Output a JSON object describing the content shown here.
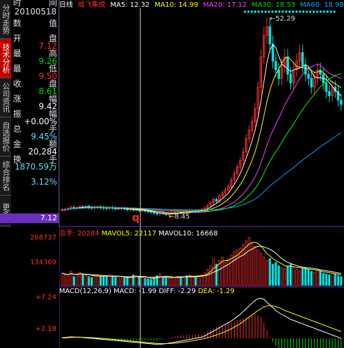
{
  "sidebar": {
    "tabs": [
      {
        "label": "分时走势",
        "active": false
      },
      {
        "label": "技术分析",
        "active": true
      },
      {
        "label": "公司资讯",
        "active": false
      },
      {
        "label": "自选报价",
        "active": false
      },
      {
        "label": "综合排名",
        "active": false
      },
      {
        "label": "更多",
        "active": false
      }
    ]
  },
  "info_panel": {
    "header_left": "时",
    "header_right": "间",
    "date": "20100518",
    "rows": [
      {
        "label": "数",
        "right": "值",
        "value": ""
      },
      {
        "label": "开",
        "right": "盘",
        "value": "7.12",
        "color": "red"
      },
      {
        "label": "最",
        "right": "高",
        "value": "9.26",
        "color": "green"
      },
      {
        "label": "最",
        "right": "低",
        "value": "9.50",
        "color": "red"
      },
      {
        "label": "收",
        "right": "盘",
        "value": "8.61",
        "color": "green"
      },
      {
        "label": "涨",
        "right": "幅",
        "value": "9.42",
        "color": "white"
      },
      {
        "label": "振",
        "right": "幅",
        "value": "+0.00%",
        "color": "white"
      },
      {
        "label": "总",
        "right": "手",
        "value": "9.45%",
        "color": "cyan"
      },
      {
        "label": "金",
        "right": "额",
        "value": "20,284",
        "color": "white"
      },
      {
        "label": "换",
        "right": "手",
        "value": "1870.59万",
        "color": "cyan"
      },
      {
        "label": "",
        "right": "",
        "value": "3.12%",
        "color": "cyan"
      }
    ],
    "cursor_price": "7.12"
  },
  "main_legend": {
    "period": "日线",
    "stock": "成飞集成",
    "ma5": "MA5: 12.32",
    "ma10": "MA10: 14.99",
    "ma20": "MA20: 17.12",
    "ma30": "MA30: 18.53",
    "ma60": "MA60: 18.98"
  },
  "annotations": {
    "high_label": "52.29",
    "low_label": "8.45",
    "cursor_marker": "q"
  },
  "volume_legend": {
    "total": "总手: 20284",
    "mavol5": "MAVOL5: 22117",
    "mavol10": "MAVOL10: 16668",
    "axis_top": "268737",
    "axis_mid": "134369"
  },
  "macd_legend": {
    "name": "MACD(12,26,9)",
    "macd": "MACD: -1.99",
    "diff": "DIFF: -2.29",
    "dea": "DEA: -1.29",
    "axis_top": "+7.24",
    "axis_mid": "+2.18"
  },
  "colors": {
    "up": "#ff3030",
    "down": "#00e000",
    "ma5": "#ffffff",
    "ma10": "#ffff00",
    "ma20": "#ff40ff",
    "ma30": "#00ff00",
    "ma60": "#00aaff",
    "panel_highlight": "#6b2fbf"
  },
  "chart_data": {
    "type": "line",
    "closes": [
      9.6,
      9.7,
      9.9,
      10.2,
      10.0,
      10.1,
      10.3,
      10.2,
      10.4,
      10.1,
      10.0,
      10.2,
      10.3,
      10.1,
      10.0,
      9.9,
      10.1,
      10.0,
      9.8,
      9.9,
      10.0,
      9.8,
      9.6,
      9.7,
      9.5,
      9.6,
      9.4,
      9.5,
      9.3,
      9.2,
      9.0,
      8.8,
      8.6,
      8.9,
      8.7,
      8.5,
      8.6,
      8.8,
      9.0,
      9.1,
      9.0,
      9.2,
      9.1,
      9.3,
      9.4,
      9.2,
      9.5,
      9.7,
      10.0,
      10.5,
      11.2,
      12.0,
      11.6,
      12.8,
      13.5,
      14.2,
      15.0,
      16.5,
      18.0,
      19.5,
      21.0,
      23.0,
      26.0,
      28.0,
      30.0,
      33.0,
      38.0,
      45.0,
      50.0,
      52.0,
      48.0,
      44.0,
      42.0,
      40.0,
      43.0,
      45.0,
      41.0,
      39.0,
      42.0,
      44.0,
      46.0,
      43.0,
      41.0,
      40.0,
      38.0,
      40.0,
      42.0,
      41.0,
      39.0,
      37.0,
      36.0,
      38.0,
      37.0,
      35.0,
      34.0
    ],
    "volumes": [
      70,
      60,
      55,
      80,
      50,
      65,
      75,
      60,
      55,
      50,
      45,
      60,
      55,
      50,
      48,
      52,
      60,
      55,
      50,
      45,
      40,
      42,
      50,
      45,
      60,
      55,
      50,
      45,
      40,
      38,
      35,
      45,
      55,
      65,
      50,
      45,
      40,
      42,
      48,
      52,
      45,
      50,
      55,
      60,
      50,
      48,
      55,
      60,
      70,
      90,
      110,
      150,
      120,
      140,
      160,
      130,
      150,
      170,
      190,
      200,
      210,
      230,
      250,
      268,
      240,
      220,
      200,
      180,
      160,
      140,
      150,
      120,
      130,
      110,
      100,
      95,
      110,
      120,
      100,
      90,
      85,
      95,
      100,
      90,
      80,
      75,
      85,
      80,
      70,
      65,
      60,
      70,
      65,
      55,
      50
    ],
    "macd_diff": [
      0.1,
      0.15,
      0.2,
      0.25,
      0.22,
      0.2,
      0.18,
      0.15,
      0.1,
      0.05,
      0.0,
      -0.05,
      -0.1,
      -0.15,
      -0.2,
      -0.25,
      -0.3,
      -0.35,
      -0.4,
      -0.45,
      -0.5,
      -0.55,
      -0.6,
      -0.65,
      -0.7,
      -0.75,
      -0.8,
      -0.85,
      -0.9,
      -0.95,
      -1.0,
      -1.05,
      -1.1,
      -1.08,
      -1.02,
      -0.95,
      -0.88,
      -0.8,
      -0.7,
      -0.6,
      -0.5,
      -0.4,
      -0.3,
      -0.2,
      -0.1,
      0.0,
      0.1,
      0.2,
      0.4,
      0.7,
      1.0,
      1.3,
      1.6,
      1.9,
      2.2,
      2.5,
      2.8,
      3.1,
      3.5,
      3.9,
      4.3,
      4.8,
      5.3,
      5.8,
      6.3,
      6.8,
      7.1,
      7.2,
      7.0,
      6.5,
      6.0,
      5.5,
      5.0,
      4.6,
      4.3,
      4.0,
      3.7,
      3.4,
      3.2,
      3.0,
      2.8,
      2.6,
      2.4,
      2.2,
      2.0,
      1.8,
      1.6,
      1.4,
      1.2,
      1.0,
      0.8,
      0.6,
      0.4,
      0.2,
      0.0
    ],
    "macd_dea": [
      0.05,
      0.08,
      0.12,
      0.16,
      0.18,
      0.19,
      0.19,
      0.18,
      0.16,
      0.14,
      0.11,
      0.08,
      0.04,
      0.0,
      -0.04,
      -0.08,
      -0.13,
      -0.18,
      -0.23,
      -0.28,
      -0.33,
      -0.38,
      -0.43,
      -0.48,
      -0.53,
      -0.58,
      -0.63,
      -0.68,
      -0.73,
      -0.78,
      -0.82,
      -0.87,
      -0.91,
      -0.94,
      -0.96,
      -0.96,
      -0.95,
      -0.92,
      -0.88,
      -0.83,
      -0.76,
      -0.69,
      -0.61,
      -0.53,
      -0.44,
      -0.35,
      -0.26,
      -0.16,
      -0.05,
      0.1,
      0.25,
      0.42,
      0.6,
      0.8,
      1.0,
      1.2,
      1.45,
      1.7,
      2.0,
      2.3,
      2.6,
      3.0,
      3.4,
      3.8,
      4.2,
      4.6,
      5.0,
      5.3,
      5.6,
      5.8,
      5.9,
      5.8,
      5.7,
      5.5,
      5.3,
      5.0,
      4.8,
      4.6,
      4.4,
      4.2,
      4.0,
      3.8,
      3.6,
      3.4,
      3.2,
      3.0,
      2.8,
      2.6,
      2.4,
      2.2,
      2.0,
      1.8,
      1.6,
      1.4,
      1.2
    ]
  }
}
